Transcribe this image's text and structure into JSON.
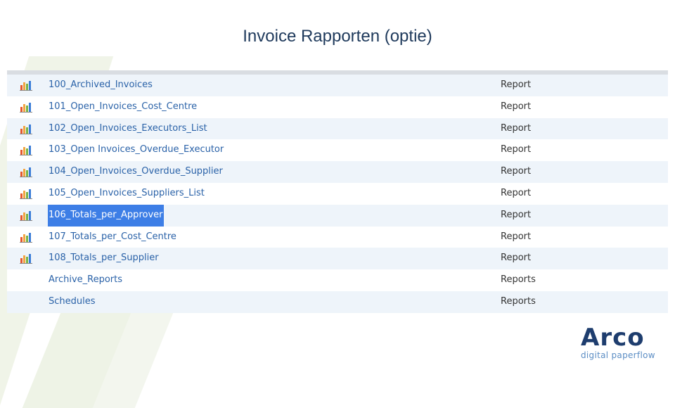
{
  "title": "Invoice Rapporten (optie)",
  "rows": [
    {
      "name": "100_Archived_Invoices",
      "type": "Report",
      "icon": "bar-chart-icon"
    },
    {
      "name": "101_Open_Invoices_Cost_Centre",
      "type": "Report",
      "icon": "bar-chart-icon"
    },
    {
      "name": "102_Open_Invoices_Executors_List",
      "type": "Report",
      "icon": "bar-chart-icon"
    },
    {
      "name": "103_Open Invoices_Overdue_Executor",
      "type": "Report",
      "icon": "bar-chart-icon"
    },
    {
      "name": "104_Open_Invoices_Overdue_Supplier",
      "type": "Report",
      "icon": "bar-chart-icon"
    },
    {
      "name": "105_Open_Invoices_Suppliers_List",
      "type": "Report",
      "icon": "bar-chart-icon"
    },
    {
      "name": "106_Totals_per_Approver",
      "type": "Report",
      "icon": "bar-chart-icon",
      "selected": true
    },
    {
      "name": "107_Totals_per_Cost_Centre",
      "type": "Report",
      "icon": "bar-chart-icon"
    },
    {
      "name": "108_Totals_per_Supplier",
      "type": "Report",
      "icon": "bar-chart-icon"
    },
    {
      "name": "Archive_Reports",
      "type": "Reports"
    },
    {
      "name": "Schedules",
      "type": "Reports"
    }
  ],
  "logo": {
    "word": "Arco",
    "tagline": "digital paperflow"
  },
  "colors": {
    "title": "#1f3a5c",
    "link": "#2a62a8",
    "selection": "#3d7ee6",
    "row_alt": "#eef4fa",
    "logo": "#1e3d6e"
  }
}
